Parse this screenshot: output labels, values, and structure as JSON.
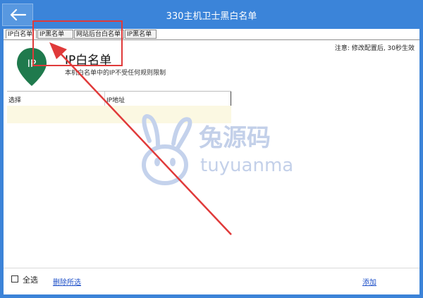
{
  "window": {
    "title": "330主机卫士黑白名单"
  },
  "tabs": [
    {
      "label": "IP白名单",
      "active": true
    },
    {
      "label": "IP黑名单",
      "active": false
    },
    {
      "label": "网站后台白名单",
      "active": false
    },
    {
      "label": "IP黑名单",
      "active": false
    }
  ],
  "hint": "注意: 修改配置后, 30秒生效",
  "ip_section": {
    "icon_label": "IP",
    "title": "IP白名单",
    "description": "本机白名单中的IP不受任何规则限制"
  },
  "table": {
    "headers": [
      "选择",
      "IP地址"
    ],
    "rows": []
  },
  "footer": {
    "select_all_label": "全选",
    "delete_label": "删除所选",
    "add_label": "添加"
  },
  "watermark": {
    "text_cn": "兔源码",
    "text_en": "tuyuanma"
  },
  "colors": {
    "titlebar": "#3b84d9",
    "icon_green": "#1f7a4d",
    "highlight": "#e03a3a",
    "row_bg": "#fbf8e2",
    "link": "#1e50c8"
  },
  "icons": {
    "back": "back-arrow-icon",
    "ip_pin": "ip-location-pin-icon",
    "annotation_arrow": "red-arrow-icon"
  }
}
